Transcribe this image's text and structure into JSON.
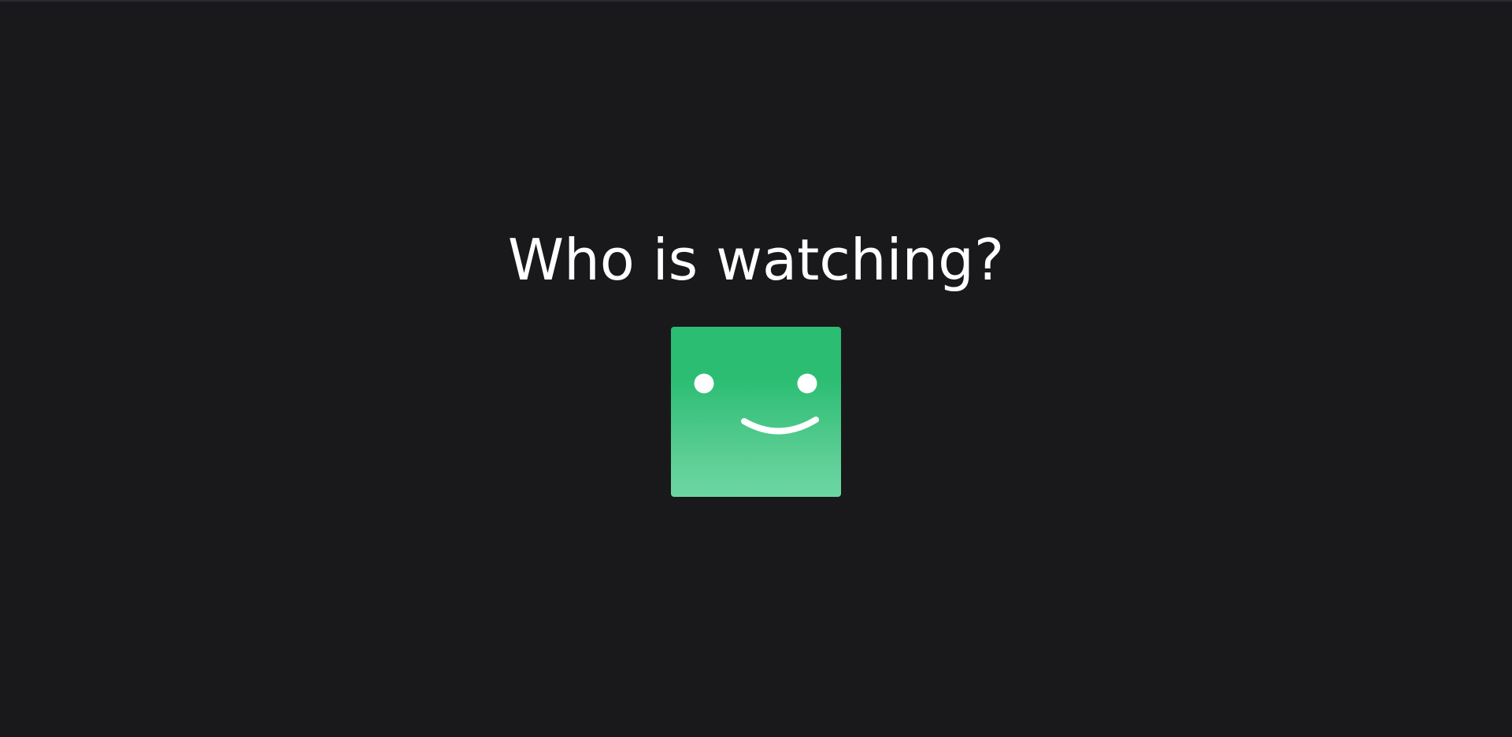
{
  "profile_gate": {
    "heading": "Who is watching?",
    "profiles": [
      {
        "avatar_icon": "smiley-face-icon",
        "avatar_color": "#2bbd72"
      }
    ]
  },
  "colors": {
    "background": "#19191b",
    "heading_text": "#ffffff",
    "avatar_face": "#ffffff"
  }
}
